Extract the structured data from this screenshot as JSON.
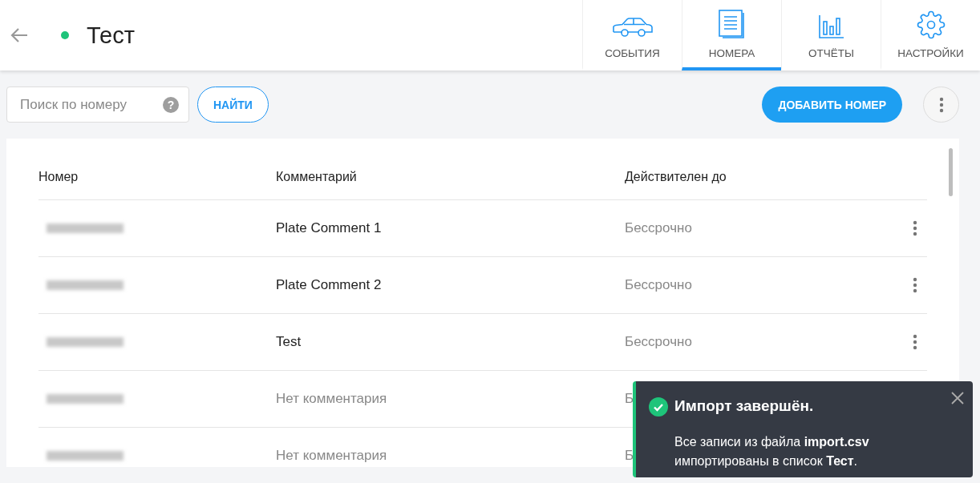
{
  "header": {
    "title": "Тест",
    "online": true
  },
  "tabs": [
    {
      "label": "СОБЫТИЯ",
      "selected": false
    },
    {
      "label": "НОМЕРА",
      "selected": true
    },
    {
      "label": "ОТЧЁТЫ",
      "selected": false
    },
    {
      "label": "НАСТРОЙКИ",
      "selected": false
    }
  ],
  "search": {
    "placeholder": "Поиск по номеру",
    "help": "?"
  },
  "find_button": "НАЙТИ",
  "add_button": "ДОБАВИТЬ НОМЕР",
  "table": {
    "columns": [
      "Номер",
      "Комментарий",
      "Действителен до"
    ],
    "rows": [
      {
        "comment": "Plate Comment 1",
        "comment_empty": false,
        "valid_until": "Бессрочно",
        "menu": true
      },
      {
        "comment": "Plate Comment 2",
        "comment_empty": false,
        "valid_until": "Бессрочно",
        "menu": true
      },
      {
        "comment": "Test",
        "comment_empty": false,
        "valid_until": "Бессрочно",
        "menu": true
      },
      {
        "comment": "Нет комментария",
        "comment_empty": true,
        "valid_until": "Б",
        "menu": false
      },
      {
        "comment": "Нет комментария",
        "comment_empty": true,
        "valid_until": "Б",
        "menu": false
      }
    ]
  },
  "toast": {
    "title": "Импорт завершён.",
    "message": "Все записи из файла **import.csv** импортированы в список **Тест**."
  }
}
